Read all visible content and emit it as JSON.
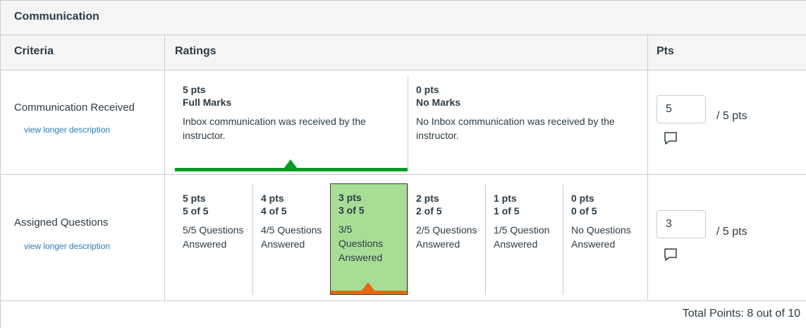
{
  "rubric": {
    "title": "Communication",
    "headers": {
      "criteria": "Criteria",
      "ratings": "Ratings",
      "pts": "Pts"
    },
    "criteria": [
      {
        "name": "Communication Received",
        "link": "view longer description",
        "ratings": [
          {
            "pts": "5 pts",
            "label": "Full Marks",
            "desc": "Inbox communication was received by the instructor.",
            "selected": true
          },
          {
            "pts": "0 pts",
            "label": "No Marks",
            "desc": "No Inbox communication was received by the instructor.",
            "selected": false
          }
        ],
        "score": "5",
        "out_of": "/ 5 pts"
      },
      {
        "name": "Assigned Questions",
        "link": "view longer description",
        "ratings": [
          {
            "pts": "5 pts",
            "label": "5 of 5",
            "desc": "5/5 Questions Answered",
            "selected": false
          },
          {
            "pts": "4 pts",
            "label": "4 of 5",
            "desc": "4/5 Questions Answered",
            "selected": false
          },
          {
            "pts": "3 pts",
            "label": "3 of 5",
            "desc": "3/5 Questions Answered",
            "selected": true
          },
          {
            "pts": "2 pts",
            "label": "2 of 5",
            "desc": "2/5 Questions Answered",
            "selected": false
          },
          {
            "pts": "1 pts",
            "label": "1 of 5",
            "desc": "1/5 Question Answered",
            "selected": false
          },
          {
            "pts": "0 pts",
            "label": "0 of 5",
            "desc": "No Questions Answered",
            "selected": false
          }
        ],
        "score": "3",
        "out_of": "/ 5 pts"
      }
    ],
    "total": "Total Points: 8 out of 10",
    "colors": {
      "selected_green": "#0b9b23",
      "selected_fill": "#a8dd96",
      "selected_orange": "#e86912",
      "link": "#2b7abc"
    },
    "icons": {
      "comment": "comment-icon"
    }
  }
}
